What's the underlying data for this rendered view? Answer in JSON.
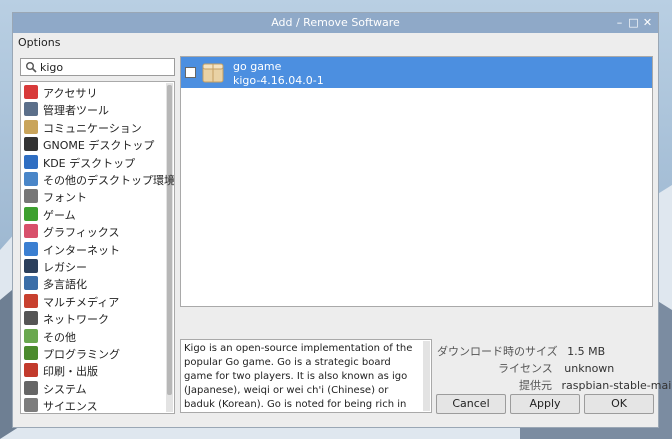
{
  "window": {
    "title": "Add / Remove Software"
  },
  "menu": {
    "options_label": "Options"
  },
  "search": {
    "value": "kigo"
  },
  "categories": [
    {
      "label": "アクセサリ",
      "icon": "accessories-icon",
      "color": "#d83a3a"
    },
    {
      "label": "管理者ツール",
      "icon": "admin-tools-icon",
      "color": "#5b6f8a"
    },
    {
      "label": "コミュニケーション",
      "icon": "communication-icon",
      "color": "#c9a45a"
    },
    {
      "label": "GNOME デスクトップ",
      "icon": "gnome-icon",
      "color": "#333333"
    },
    {
      "label": "KDE デスクトップ",
      "icon": "kde-icon",
      "color": "#2f6ec2"
    },
    {
      "label": "その他のデスクトップ環境",
      "icon": "desktop-icon",
      "color": "#4a86c8"
    },
    {
      "label": "フォント",
      "icon": "font-icon",
      "color": "#777777"
    },
    {
      "label": "ゲーム",
      "icon": "games-icon",
      "color": "#3da02f"
    },
    {
      "label": "グラフィックス",
      "icon": "graphics-icon",
      "color": "#d8506b"
    },
    {
      "label": "インターネット",
      "icon": "internet-icon",
      "color": "#3b7fd1"
    },
    {
      "label": "レガシー",
      "icon": "legacy-icon",
      "color": "#2b3f5c"
    },
    {
      "label": "多言語化",
      "icon": "localization-icon",
      "color": "#3b6ea8"
    },
    {
      "label": "マルチメディア",
      "icon": "multimedia-icon",
      "color": "#c8402e"
    },
    {
      "label": "ネットワーク",
      "icon": "network-icon",
      "color": "#555555"
    },
    {
      "label": "その他",
      "icon": "other-icon",
      "color": "#6aa84f"
    },
    {
      "label": "プログラミング",
      "icon": "programming-icon",
      "color": "#4b8b2d"
    },
    {
      "label": "印刷・出版",
      "icon": "publishing-icon",
      "color": "#c23a2c"
    },
    {
      "label": "システム",
      "icon": "system-icon",
      "color": "#666666"
    },
    {
      "label": "サイエンス",
      "icon": "science-icon",
      "color": "#7d7d7d"
    }
  ],
  "package": {
    "name": "go game",
    "version": "kigo-4.16.04.0-1",
    "icon": "package-box-icon",
    "selected_color": "#4c8fe0"
  },
  "description": {
    "text": "Kigo is an open-source implementation of the popular Go game. Go is a strategic board game for two players. It is also known as igo (Japanese), weiqi or wei ch'i (Chinese) or baduk (Korean). Go is noted for being rich in strategic complexity despite"
  },
  "details": {
    "download_size_label": "ダウンロード時のサイズ",
    "download_size_value": "1.5 MB",
    "license_label": "ライセンス",
    "license_value": "unknown",
    "provider_label": "提供元",
    "provider_value": "raspbian-stable-main"
  },
  "buttons": {
    "cancel": "Cancel",
    "apply": "Apply",
    "ok": "OK"
  }
}
